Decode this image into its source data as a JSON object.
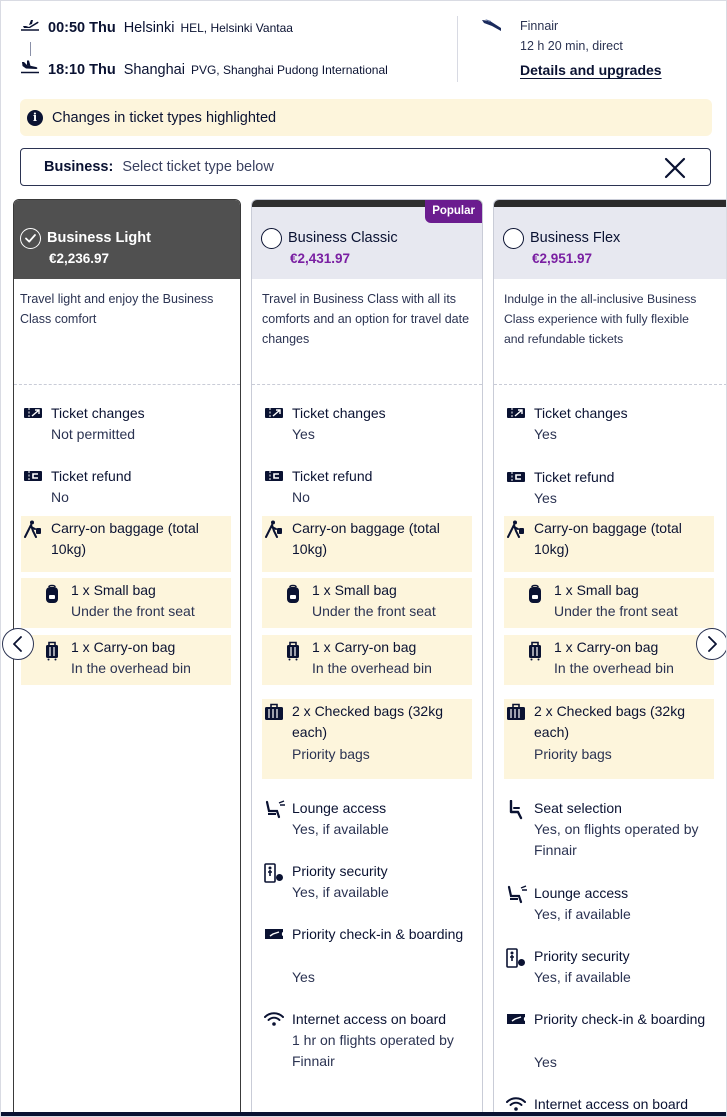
{
  "flight": {
    "departure": {
      "time": "00:50 Thu",
      "city": "Helsinki",
      "airport": "HEL, Helsinki Vantaa"
    },
    "arrival": {
      "time": "18:10 Thu",
      "city": "Shanghai",
      "airport": "PVG, Shanghai Pudong International"
    },
    "airline": "Finnair",
    "duration": "12 h 20 min, direct",
    "details_link": "Details and upgrades"
  },
  "notice": {
    "text": "Changes in ticket types highlighted",
    "icon": "info-icon"
  },
  "cabin": {
    "label": "Business:",
    "prompt": "Select ticket type below"
  },
  "colors": {
    "price": "#7a1fa2",
    "popular_badge": "#6b1c8f",
    "highlight": "#fdf5dc",
    "selected_header": "#505050"
  },
  "fares": [
    {
      "name": "Business Light",
      "price": "€2,236.97",
      "selected": true,
      "description": "Travel light and enjoy the Business Class comfort",
      "features": [
        {
          "icon": "ticket-change-icon",
          "title": "Ticket changes",
          "value": "Not permitted"
        },
        {
          "icon": "ticket-refund-icon",
          "title": "Ticket refund",
          "value": "No"
        },
        {
          "icon": "walking-luggage-icon",
          "title": "Carry-on baggage (total 10kg)",
          "value": ""
        },
        {
          "icon": "backpack-icon",
          "title": "1 x Small bag",
          "value": "Under the front seat"
        },
        {
          "icon": "suitcase-icon",
          "title": "1 x Carry-on bag",
          "value": "In the overhead bin"
        }
      ]
    },
    {
      "name": "Business Classic",
      "price": "€2,431.97",
      "selected": false,
      "badge": "Popular",
      "description": "Travel in Business Class with all its comforts and an option for travel date changes",
      "features": [
        {
          "icon": "ticket-change-icon",
          "title": "Ticket changes",
          "value": "Yes"
        },
        {
          "icon": "ticket-refund-icon",
          "title": "Ticket refund",
          "value": "No"
        },
        {
          "icon": "walking-luggage-icon",
          "title": "Carry-on baggage (total 10kg)",
          "value": ""
        },
        {
          "icon": "backpack-icon",
          "title": "1 x Small bag",
          "value": "Under the front seat"
        },
        {
          "icon": "suitcase-icon",
          "title": "1 x Carry-on bag",
          "value": "In the overhead bin"
        },
        {
          "icon": "checked-bags-icon",
          "title": "2 x Checked bags (32kg each)",
          "value": "Priority bags"
        },
        {
          "icon": "lounge-icon",
          "title": "Lounge access",
          "value": "Yes, if available"
        },
        {
          "icon": "priority-security-icon",
          "title": "Priority security",
          "value": "Yes, if available"
        },
        {
          "icon": "priority-boarding-icon",
          "title": "Priority check-in & boarding",
          "value": "Yes"
        },
        {
          "icon": "wifi-icon",
          "title": "Internet access on board",
          "value": "1 hr on flights operated by Finnair"
        }
      ]
    },
    {
      "name": "Business Flex",
      "price": "€2,951.97",
      "selected": false,
      "description": "Indulge in the all-inclusive Business Class experience with fully flexible and refundable tickets",
      "features": [
        {
          "icon": "ticket-change-icon",
          "title": "Ticket changes",
          "value": "Yes"
        },
        {
          "icon": "ticket-refund-icon",
          "title": "Ticket refund",
          "value": "Yes"
        },
        {
          "icon": "walking-luggage-icon",
          "title": "Carry-on baggage (total 10kg)",
          "value": ""
        },
        {
          "icon": "backpack-icon",
          "title": "1 x Small bag",
          "value": "Under the front seat"
        },
        {
          "icon": "suitcase-icon",
          "title": "1 x Carry-on bag",
          "value": "In the overhead bin"
        },
        {
          "icon": "checked-bags-icon",
          "title": "2 x Checked bags (32kg each)",
          "value": "Priority bags"
        },
        {
          "icon": "seat-icon",
          "title": "Seat selection",
          "value": "Yes, on flights operated by Finnair"
        },
        {
          "icon": "lounge-icon",
          "title": "Lounge access",
          "value": "Yes, if available"
        },
        {
          "icon": "priority-security-icon",
          "title": "Priority security",
          "value": "Yes, if available"
        },
        {
          "icon": "priority-boarding-icon",
          "title": "Priority check-in & boarding",
          "value": "Yes"
        },
        {
          "icon": "wifi-icon",
          "title": "Internet access on board",
          "value": ""
        }
      ]
    }
  ]
}
